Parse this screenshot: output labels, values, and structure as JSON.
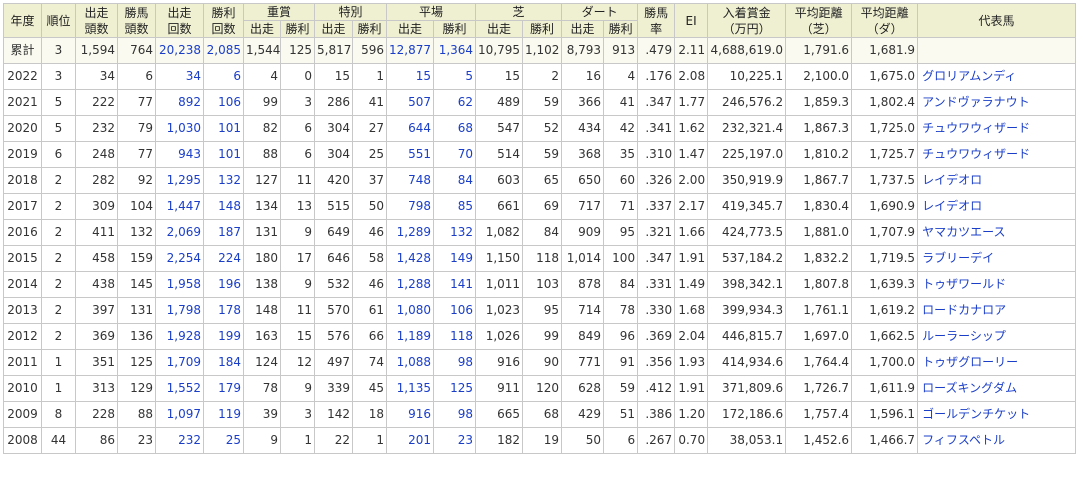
{
  "headers": {
    "year": "年度",
    "rank": "順位",
    "starters": [
      "出走",
      "頭数"
    ],
    "winners": [
      "勝馬",
      "頭数"
    ],
    "runs": [
      "出走",
      "回数"
    ],
    "wins": [
      "勝利",
      "回数"
    ],
    "graded": "重賞",
    "special": "特別",
    "flat": "平場",
    "turf": "芝",
    "dirt": "ダート",
    "sub_run": "出走",
    "sub_win": "勝利",
    "win_rate": [
      "勝馬",
      "率"
    ],
    "ei": "EI",
    "earnings": [
      "入着賞金",
      "（万円）"
    ],
    "avg_turf": [
      "平均距離",
      "（芝）"
    ],
    "avg_dirt": [
      "平均距離",
      "（ダ）"
    ],
    "horse": "代表馬"
  },
  "rows": [
    [
      "累計",
      "3",
      "1,594",
      "764",
      "20,238",
      "2,085",
      "1,544",
      "125",
      "5,817",
      "596",
      "12,877",
      "1,364",
      "10,795",
      "1,102",
      "8,793",
      "913",
      ".479",
      "2.11",
      "4,688,619.0",
      "1,791.6",
      "1,681.9",
      ""
    ],
    [
      "2022",
      "3",
      "34",
      "6",
      "34",
      "6",
      "4",
      "0",
      "15",
      "1",
      "15",
      "5",
      "15",
      "2",
      "16",
      "4",
      ".176",
      "2.08",
      "10,225.1",
      "2,100.0",
      "1,675.0",
      "グロリアムンディ"
    ],
    [
      "2021",
      "5",
      "222",
      "77",
      "892",
      "106",
      "99",
      "3",
      "286",
      "41",
      "507",
      "62",
      "489",
      "59",
      "366",
      "41",
      ".347",
      "1.77",
      "246,576.2",
      "1,859.3",
      "1,802.4",
      "アンドヴァラナウト"
    ],
    [
      "2020",
      "5",
      "232",
      "79",
      "1,030",
      "101",
      "82",
      "6",
      "304",
      "27",
      "644",
      "68",
      "547",
      "52",
      "434",
      "42",
      ".341",
      "1.62",
      "232,321.4",
      "1,867.3",
      "1,725.0",
      "チュウワウィザード"
    ],
    [
      "2019",
      "6",
      "248",
      "77",
      "943",
      "101",
      "88",
      "6",
      "304",
      "25",
      "551",
      "70",
      "514",
      "59",
      "368",
      "35",
      ".310",
      "1.47",
      "225,197.0",
      "1,810.2",
      "1,725.7",
      "チュウワウィザード"
    ],
    [
      "2018",
      "2",
      "282",
      "92",
      "1,295",
      "132",
      "127",
      "11",
      "420",
      "37",
      "748",
      "84",
      "603",
      "65",
      "650",
      "60",
      ".326",
      "2.00",
      "350,919.9",
      "1,867.7",
      "1,737.5",
      "レイデオロ"
    ],
    [
      "2017",
      "2",
      "309",
      "104",
      "1,447",
      "148",
      "134",
      "13",
      "515",
      "50",
      "798",
      "85",
      "661",
      "69",
      "717",
      "71",
      ".337",
      "2.17",
      "419,345.7",
      "1,830.4",
      "1,690.9",
      "レイデオロ"
    ],
    [
      "2016",
      "2",
      "411",
      "132",
      "2,069",
      "187",
      "131",
      "9",
      "649",
      "46",
      "1,289",
      "132",
      "1,082",
      "84",
      "909",
      "95",
      ".321",
      "1.66",
      "424,773.5",
      "1,881.0",
      "1,707.9",
      "ヤマカツエース"
    ],
    [
      "2015",
      "2",
      "458",
      "159",
      "2,254",
      "224",
      "180",
      "17",
      "646",
      "58",
      "1,428",
      "149",
      "1,150",
      "118",
      "1,014",
      "100",
      ".347",
      "1.91",
      "537,184.2",
      "1,832.2",
      "1,719.5",
      "ラブリーデイ"
    ],
    [
      "2014",
      "2",
      "438",
      "145",
      "1,958",
      "196",
      "138",
      "9",
      "532",
      "46",
      "1,288",
      "141",
      "1,011",
      "103",
      "878",
      "84",
      ".331",
      "1.49",
      "398,342.1",
      "1,807.8",
      "1,639.3",
      "トゥザワールド"
    ],
    [
      "2013",
      "2",
      "397",
      "131",
      "1,798",
      "178",
      "148",
      "11",
      "570",
      "61",
      "1,080",
      "106",
      "1,023",
      "95",
      "714",
      "78",
      ".330",
      "1.68",
      "399,934.3",
      "1,761.1",
      "1,619.2",
      "ロードカナロア"
    ],
    [
      "2012",
      "2",
      "369",
      "136",
      "1,928",
      "199",
      "163",
      "15",
      "576",
      "66",
      "1,189",
      "118",
      "1,026",
      "99",
      "849",
      "96",
      ".369",
      "2.04",
      "446,815.7",
      "1,697.0",
      "1,662.5",
      "ルーラーシップ"
    ],
    [
      "2011",
      "1",
      "351",
      "125",
      "1,709",
      "184",
      "124",
      "12",
      "497",
      "74",
      "1,088",
      "98",
      "916",
      "90",
      "771",
      "91",
      ".356",
      "1.93",
      "414,934.6",
      "1,764.4",
      "1,700.0",
      "トゥザグローリー"
    ],
    [
      "2010",
      "1",
      "313",
      "129",
      "1,552",
      "179",
      "78",
      "9",
      "339",
      "45",
      "1,135",
      "125",
      "911",
      "120",
      "628",
      "59",
      ".412",
      "1.91",
      "371,809.6",
      "1,726.7",
      "1,611.9",
      "ローズキングダム"
    ],
    [
      "2009",
      "8",
      "228",
      "88",
      "1,097",
      "119",
      "39",
      "3",
      "142",
      "18",
      "916",
      "98",
      "665",
      "68",
      "429",
      "51",
      ".386",
      "1.20",
      "172,186.6",
      "1,757.4",
      "1,596.1",
      "ゴールデンチケット"
    ],
    [
      "2008",
      "44",
      "86",
      "23",
      "232",
      "25",
      "9",
      "1",
      "22",
      "1",
      "201",
      "23",
      "182",
      "19",
      "50",
      "6",
      ".267",
      "0.70",
      "38,053.1",
      "1,452.6",
      "1,466.7",
      "フィフスペトル"
    ]
  ]
}
